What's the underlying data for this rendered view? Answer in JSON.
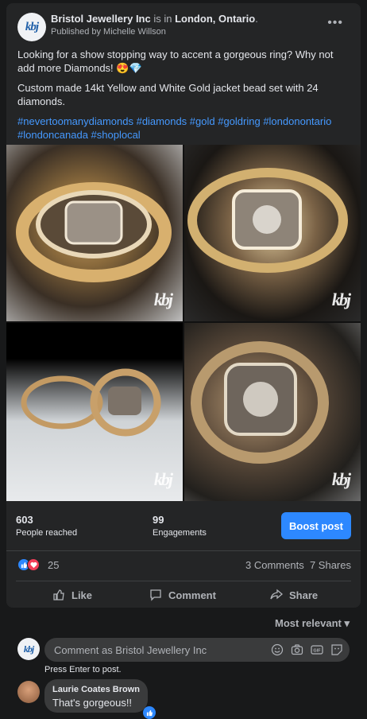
{
  "header": {
    "page_name": "Bristol Jewellery Inc",
    "is_in": "is in",
    "location": "London, Ontario",
    "period": ".",
    "published_by": "Published by Michelle Willson",
    "logo_text": "kbj"
  },
  "post": {
    "text1": "Looking for a show stopping way to accent a gorgeous ring? Why not add more Diamonds! 😍💎",
    "text2": "Custom made 14kt Yellow and White Gold jacket bead set with 24 diamonds.",
    "hashtags": "#nevertoomanydiamonds #diamonds #gold #goldring #londonontario #londoncanada #shoplocal",
    "watermark": "kbj"
  },
  "stats": {
    "reached_value": "603",
    "reached_label": "People reached",
    "engagements_value": "99",
    "engagements_label": "Engagements",
    "boost_label": "Boost post"
  },
  "reactions": {
    "count": "25",
    "comments": "3 Comments",
    "shares": "7 Shares"
  },
  "actions": {
    "like": "Like",
    "comment": "Comment",
    "share": "Share"
  },
  "comments": {
    "sort_label": "Most relevant",
    "placeholder": "Comment as Bristol Jewellery Inc",
    "hint": "Press Enter to post.",
    "first": {
      "author": "Laurie Coates Brown",
      "text": "That's gorgeous!!"
    }
  },
  "colors": {
    "background": "#18191a",
    "card": "#242526",
    "accent": "#2d88ff",
    "hashtag": "#4599ff"
  }
}
